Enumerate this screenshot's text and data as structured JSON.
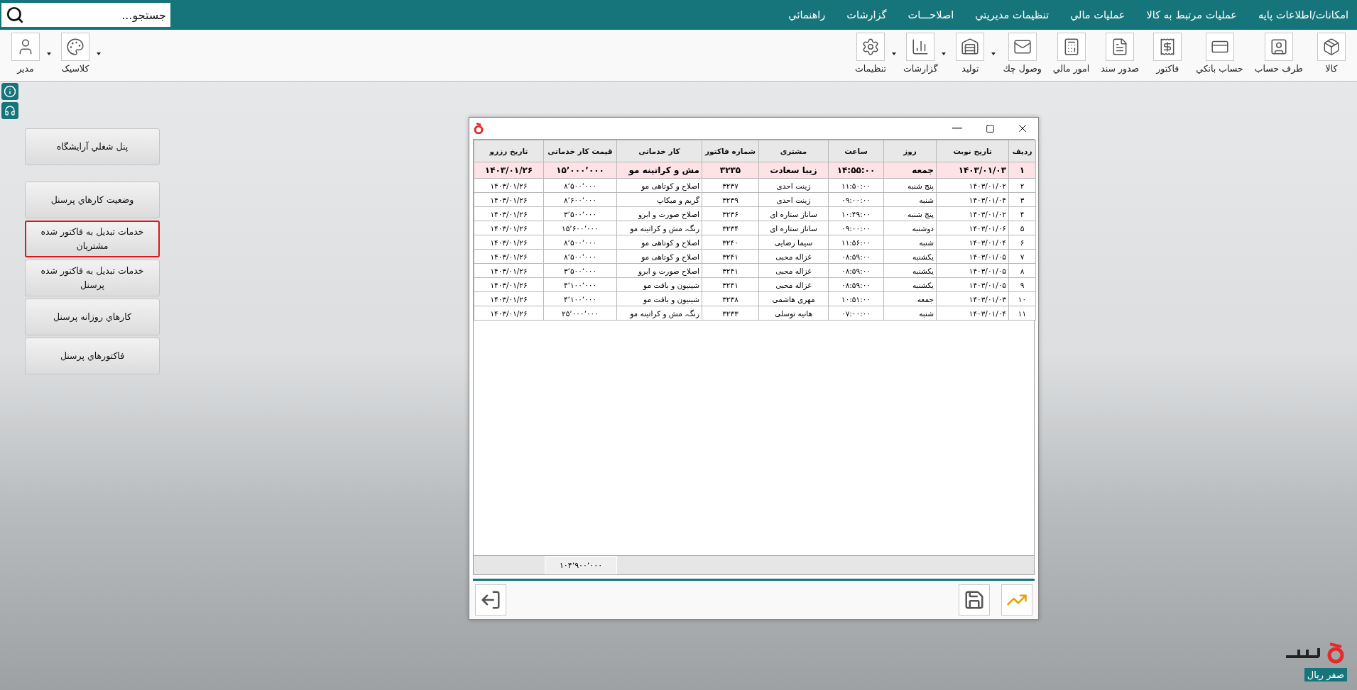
{
  "search": {
    "placeholder": "جستجو..."
  },
  "menu": [
    "امکانات/اطلاعات پایه",
    "عملیات مرتبط به کالا",
    "عملیات مالي",
    "تنظیمات مدیریتي",
    "اصلاحـــات",
    "گزارشات",
    "راهنمائي"
  ],
  "toolbar": {
    "items": [
      {
        "label": "کالا",
        "has_menu": false
      },
      {
        "label": "طرف حساب",
        "has_menu": false
      },
      {
        "label": "حساب بانكي",
        "has_menu": false
      },
      {
        "label": "فاكتور",
        "has_menu": false
      },
      {
        "label": "صدور سند",
        "has_menu": false
      },
      {
        "label": "امور مالي",
        "has_menu": false
      },
      {
        "label": "وصول چك",
        "has_menu": false
      },
      {
        "label": "تولید",
        "has_menu": true
      },
      {
        "label": "گزارشات",
        "has_menu": true
      },
      {
        "label": "تنظیمات",
        "has_menu": true
      }
    ],
    "user_items": [
      {
        "label": "کلاسیک",
        "has_menu": true
      },
      {
        "label": "مدیر",
        "has_menu": true
      }
    ]
  },
  "sidebar": {
    "items": [
      {
        "label": "پنل شغلي آرايشگاه",
        "selected": false
      },
      {
        "label": "وضعیت  کارهاي  پرسنل",
        "selected": false
      },
      {
        "label": "خدمات تبديل به فاكتور شده مشتريان",
        "selected": true
      },
      {
        "label": "خدمات تبديل به فاكتور شده پرسنل",
        "selected": false
      },
      {
        "label": "کارهاي  روزانه  پرسنل",
        "selected": false
      },
      {
        "label": "فاکتورهاي پرسنل",
        "selected": false
      }
    ]
  },
  "dialog": {
    "table": {
      "columns": [
        "ردیف",
        "تاریخ نوبت",
        "روز",
        "ساعت",
        "مشتری",
        "شماره فاکتور",
        "کار خدماتی",
        "قیمت کار خدماتی",
        "تاریخ رزرو"
      ],
      "rows": [
        {
          "selected": true,
          "cells": [
            "۱",
            "۱۴۰۳/۰۱/۰۳",
            "جمعه",
            "۱۴:۵۵:۰۰",
            "زیبا سعادت",
            "۳۲۳۵",
            "مش و کراتینه مو",
            "۱۵٬۰۰۰٬۰۰۰",
            "۱۴۰۳/۰۱/۲۶"
          ]
        },
        {
          "selected": false,
          "cells": [
            "۲",
            "۱۴۰۳/۰۱/۰۲",
            "پنج شنبه",
            "۱۱:۵۰:۰۰",
            "زینت احدی",
            "۳۲۳۷",
            "اصلاح و کوتاهی مو",
            "۸٬۵۰۰٬۰۰۰",
            "۱۴۰۳/۰۱/۲۶"
          ]
        },
        {
          "selected": false,
          "cells": [
            "۳",
            "۱۴۰۳/۰۱/۰۴",
            "شنبه",
            "۰۹:۰۰:۰۰",
            "زینت احدی",
            "۳۲۳۹",
            "گریم و میکاپ",
            "۸٬۶۰۰٬۰۰۰",
            "۱۴۰۳/۰۱/۲۶"
          ]
        },
        {
          "selected": false,
          "cells": [
            "۴",
            "۱۴۰۳/۰۱/۰۲",
            "پنج شنبه",
            "۱۰:۴۹:۰۰",
            "ساناز ستاره ای",
            "۳۲۳۶",
            "اصلاح صورت و ابرو",
            "۳٬۵۰۰٬۰۰۰",
            "۱۴۰۳/۰۱/۲۶"
          ]
        },
        {
          "selected": false,
          "cells": [
            "۵",
            "۱۴۰۳/۰۱/۰۶",
            "دوشنبه",
            "۰۹:۰۰:۰۰",
            "ساناز ستاره ای",
            "۳۲۳۴",
            "رنگ، مش و کراتینه مو",
            "۱۵٬۶۰۰٬۰۰۰",
            "۱۴۰۳/۰۱/۲۶"
          ]
        },
        {
          "selected": false,
          "cells": [
            "۶",
            "۱۴۰۳/۰۱/۰۴",
            "شنبه",
            "۱۱:۵۶:۰۰",
            "سیما رضایی",
            "۳۲۴۰",
            "اصلاح و کوتاهی مو",
            "۸٬۵۰۰٬۰۰۰",
            "۱۴۰۳/۰۱/۲۶"
          ]
        },
        {
          "selected": false,
          "cells": [
            "۷",
            "۱۴۰۳/۰۱/۰۵",
            "یکشنبه",
            "۰۸:۵۹:۰۰",
            "غزاله محبی",
            "۳۲۴۱",
            "اصلاح و کوتاهی مو",
            "۸٬۵۰۰٬۰۰۰",
            "۱۴۰۳/۰۱/۲۶"
          ]
        },
        {
          "selected": false,
          "cells": [
            "۸",
            "۱۴۰۳/۰۱/۰۵",
            "یکشنبه",
            "۰۸:۵۹:۰۰",
            "غزاله محبی",
            "۳۲۴۱",
            "اصلاح صورت و ابرو",
            "۳٬۵۰۰٬۰۰۰",
            "۱۴۰۳/۰۱/۲۶"
          ]
        },
        {
          "selected": false,
          "cells": [
            "۹",
            "۱۴۰۳/۰۱/۰۵",
            "یکشنبه",
            "۰۸:۵۹:۰۰",
            "غزاله محبی",
            "۳۲۴۱",
            "شینیون و بافت مو",
            "۴٬۱۰۰٬۰۰۰",
            "۱۴۰۳/۰۱/۲۶"
          ]
        },
        {
          "selected": false,
          "cells": [
            "۱۰",
            "۱۴۰۳/۰۱/۰۳",
            "جمعه",
            "۱۰:۵۱:۰۰",
            "مهری هاشمی",
            "۳۲۳۸",
            "شینیون و بافت مو",
            "۴٬۱۰۰٬۰۰۰",
            "۱۴۰۳/۰۱/۲۶"
          ]
        },
        {
          "selected": false,
          "cells": [
            "۱۱",
            "۱۴۰۳/۰۱/۰۴",
            "شنبه",
            "۰۷:۰۰:۰۰",
            "هانیه توسلی",
            "۳۲۳۳",
            "رنگ، مش و کراتینه مو",
            "۲۵٬۰۰۰٬۰۰۰",
            "۱۴۰۳/۰۱/۲۶"
          ]
        }
      ],
      "total": "۱۰۴٬۹۰۰٬۰۰۰"
    }
  },
  "badge": "صفر ريال"
}
